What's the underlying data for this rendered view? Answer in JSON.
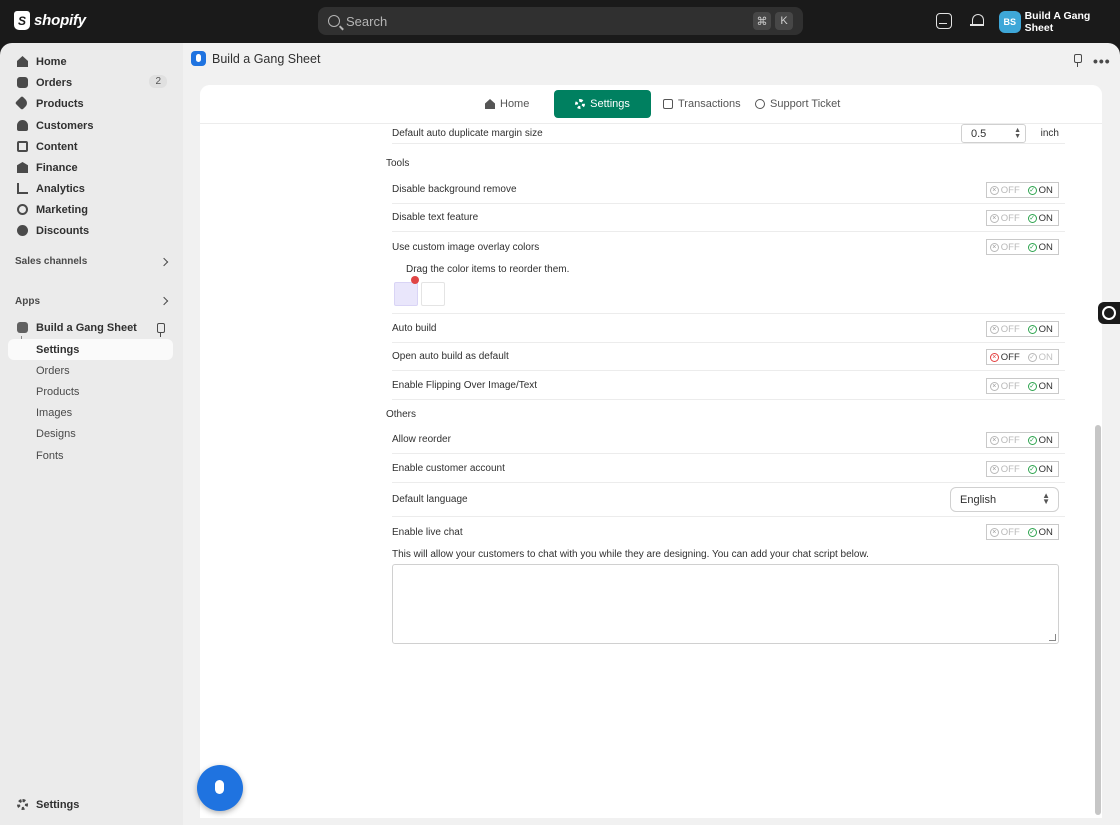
{
  "topbar": {
    "brand": "shopify",
    "search_placeholder": "Search",
    "shortcut_keys": [
      "⌘",
      "K"
    ],
    "store_initials": "BS",
    "store_name": "Build A Gang Sheet"
  },
  "sidebar": {
    "items": [
      {
        "label": "Home",
        "icon": "home-icon"
      },
      {
        "label": "Orders",
        "icon": "orders-icon",
        "badge": "2"
      },
      {
        "label": "Products",
        "icon": "products-icon"
      },
      {
        "label": "Customers",
        "icon": "customers-icon"
      },
      {
        "label": "Content",
        "icon": "content-icon"
      },
      {
        "label": "Finance",
        "icon": "finance-icon"
      },
      {
        "label": "Analytics",
        "icon": "analytics-icon"
      },
      {
        "label": "Marketing",
        "icon": "marketing-icon"
      },
      {
        "label": "Discounts",
        "icon": "discounts-icon"
      }
    ],
    "sales_channels_label": "Sales channels",
    "apps_label": "Apps",
    "app_name": "Build a Gang Sheet",
    "app_sub_items": [
      "Settings",
      "Orders",
      "Products",
      "Images",
      "Designs",
      "Fonts"
    ],
    "active_sub_item": "Settings",
    "settings_label": "Settings"
  },
  "main": {
    "app_title": "Build a Gang Sheet",
    "more_label": "•••",
    "tabs": [
      {
        "label": "Home",
        "icon": "home-icon",
        "active": false
      },
      {
        "label": "Settings",
        "icon": "gear-icon",
        "active": true
      },
      {
        "label": "Transactions",
        "icon": "transactions-icon",
        "active": false
      },
      {
        "label": "Support Ticket",
        "icon": "help-icon",
        "active": false
      }
    ],
    "accent_color": "#008060",
    "margin_row": {
      "label": "Default auto duplicate margin size",
      "value": "0.5",
      "unit": "inch"
    },
    "tools_label": "Tools",
    "tools": [
      {
        "label": "Disable background remove",
        "state": "ON"
      },
      {
        "label": "Disable text feature",
        "state": "ON"
      },
      {
        "label": "Use custom image overlay colors",
        "state": "ON"
      }
    ],
    "color_hint": "Drag the color items to reorder them.",
    "auto_build": [
      {
        "label": "Auto build",
        "state": "ON"
      },
      {
        "label": "Open auto build as default",
        "state": "OFF"
      },
      {
        "label": "Enable Flipping Over Image/Text",
        "state": "ON"
      }
    ],
    "others_label": "Others",
    "others": [
      {
        "label": "Allow reorder",
        "state": "ON"
      },
      {
        "label": "Enable customer account",
        "state": "ON"
      }
    ],
    "language_row": {
      "label": "Default language",
      "value": "English"
    },
    "live_chat": {
      "label": "Enable live chat",
      "state": "ON",
      "hint": "This will allow your customers to chat with you while they are designing. You can add your chat script below."
    },
    "toggle_off_label": "OFF",
    "toggle_on_label": "ON"
  }
}
